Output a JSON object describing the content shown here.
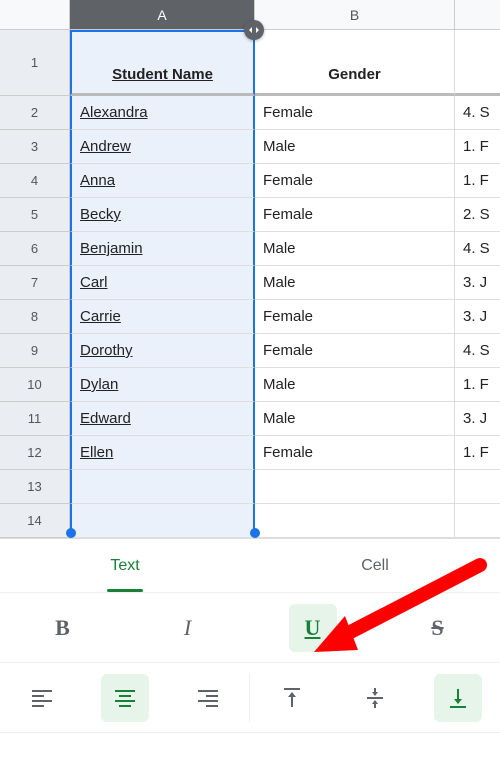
{
  "columns": {
    "A": "A",
    "B": "B"
  },
  "header_row": {
    "num": "1",
    "a": "Student Name",
    "b": "Gender"
  },
  "rows": [
    {
      "num": "2",
      "a": "Alexandra",
      "b": "Female",
      "c": "4. S"
    },
    {
      "num": "3",
      "a": "Andrew",
      "b": "Male",
      "c": "1. F"
    },
    {
      "num": "4",
      "a": "Anna",
      "b": "Female",
      "c": "1. F"
    },
    {
      "num": "5",
      "a": "Becky",
      "b": "Female",
      "c": "2. S"
    },
    {
      "num": "6",
      "a": "Benjamin",
      "b": "Male",
      "c": "4. S"
    },
    {
      "num": "7",
      "a": "Carl",
      "b": "Male",
      "c": "3. J"
    },
    {
      "num": "8",
      "a": "Carrie",
      "b": "Female",
      "c": "3. J"
    },
    {
      "num": "9",
      "a": "Dorothy",
      "b": "Female",
      "c": "4. S"
    },
    {
      "num": "10",
      "a": "Dylan",
      "b": "Male",
      "c": "1. F"
    },
    {
      "num": "11",
      "a": "Edward",
      "b": "Male",
      "c": "3. J"
    },
    {
      "num": "12",
      "a": "Ellen",
      "b": "Female",
      "c": "1. F"
    }
  ],
  "empty_rows": [
    "13",
    "14"
  ],
  "tabs": {
    "text": "Text",
    "cell": "Cell"
  },
  "format": {
    "bold": "B",
    "italic": "I",
    "underline": "U",
    "strike": "S"
  }
}
